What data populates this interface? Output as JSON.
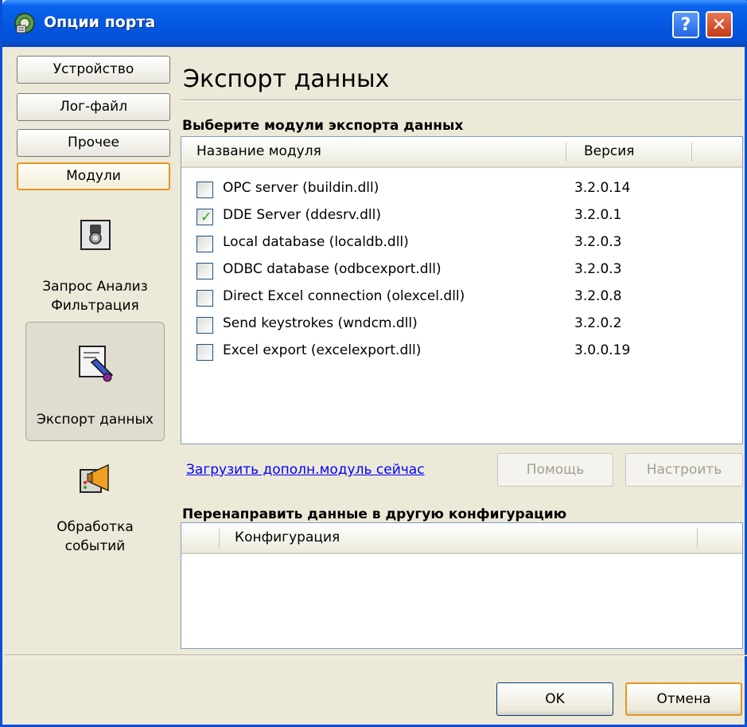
{
  "window": {
    "title": "Опции порта",
    "help_label": "?",
    "close_label": "✕"
  },
  "nav": {
    "buttons": [
      {
        "label": "Устройство",
        "active": false
      },
      {
        "label": "Лог-файл",
        "active": false
      },
      {
        "label": "Прочее",
        "active": false
      },
      {
        "label": "Модули",
        "active": true
      }
    ],
    "categories": [
      {
        "label": "Запрос Анализ Фильтрация",
        "icon": "query-filter-icon",
        "selected": false
      },
      {
        "label": "Экспорт данных",
        "icon": "data-export-icon",
        "selected": true
      },
      {
        "label": "Обработка событий",
        "icon": "event-processing-icon",
        "selected": false
      }
    ]
  },
  "main": {
    "title": "Экспорт данных",
    "modules_section": {
      "title": "Выберите модули экспорта данных",
      "columns": [
        "Название модуля",
        "Версия"
      ],
      "rows": [
        {
          "name": "OPC server (buildin.dll)",
          "version": "3.2.0.14",
          "checked": false
        },
        {
          "name": "DDE Server (ddesrv.dll)",
          "version": "3.2.0.1",
          "checked": true
        },
        {
          "name": "Local database (localdb.dll)",
          "version": "3.2.0.3",
          "checked": false
        },
        {
          "name": "ODBC database (odbcexport.dll)",
          "version": "3.2.0.3",
          "checked": false
        },
        {
          "name": "Direct Excel connection (olexcel.dll)",
          "version": "3.2.0.8",
          "checked": false
        },
        {
          "name": "Send keystrokes (wndcm.dll)",
          "version": "3.2.0.2",
          "checked": false
        },
        {
          "name": "Excel export (excelexport.dll)",
          "version": "3.0.0.19",
          "checked": false
        }
      ],
      "load_link": "Загрузить дополн.модуль сейчас",
      "help_button": "Помощь",
      "configure_button": "Настроить"
    },
    "redirect_section": {
      "title": "Перенаправить данные в другую конфигурацию",
      "columns": [
        "Конфигурация"
      ]
    }
  },
  "footer": {
    "ok_label": "OK",
    "cancel_label": "Отмена"
  },
  "colors": {
    "title_bar": "#0558e2",
    "dialog_bg": "#ece9d8",
    "active_border": "#e5961e",
    "link": "#0000ff"
  }
}
